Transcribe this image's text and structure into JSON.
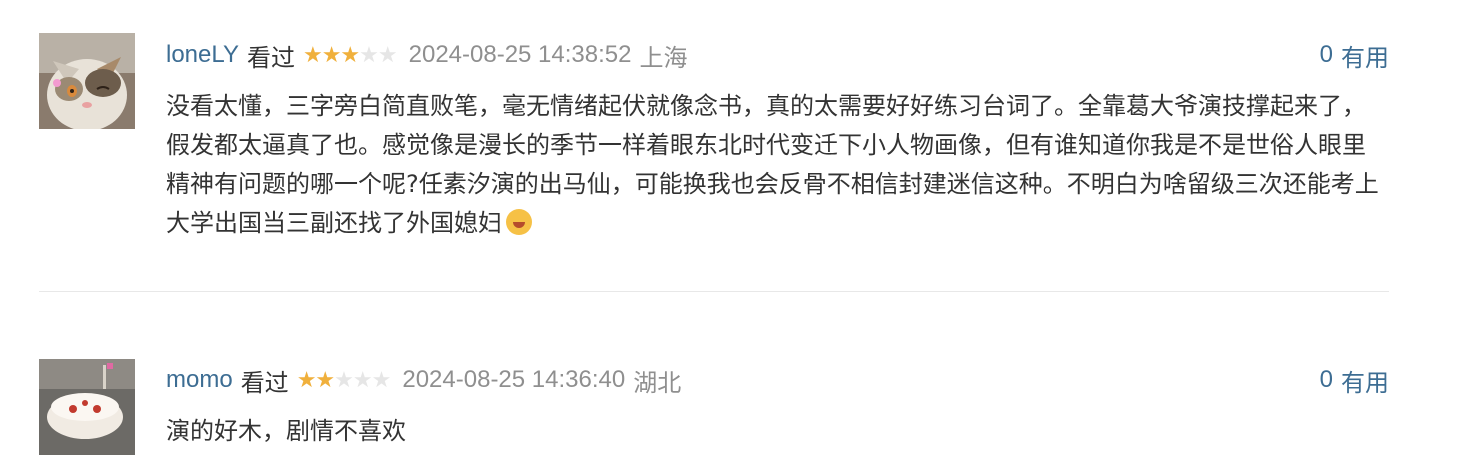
{
  "comments": [
    {
      "user": "loneLY",
      "status": "看过",
      "rating": 3,
      "max_rating": 5,
      "time": "2024-08-25 14:38:52",
      "location": "上海",
      "votes": "0",
      "vote_label": "有用",
      "text": "没看太懂，三字旁白简直败笔，毫无情绪起伏就像念书，真的太需要好好练习台词了。全靠葛大爷演技撑起来了，假发都太逼真了也。感觉像是漫长的季节一样着眼东北时代变迁下小人物画像，但有谁知道你我是不是世俗人眼里精神有问题的哪一个呢?任素汐演的出马仙，可能换我也会反骨不相信封建迷信这种。不明白为啥留级三次还能考上大学出国当三副还找了外国媳妇",
      "emoji": "rofl-emoji",
      "avatar": "cat-avatar"
    },
    {
      "user": "momo",
      "status": "看过",
      "rating": 2,
      "max_rating": 5,
      "time": "2024-08-25 14:36:40",
      "location": "湖北",
      "votes": "0",
      "vote_label": "有用",
      "text": "演的好木，剧情不喜欢",
      "avatar": "cake-avatar"
    }
  ],
  "colors": {
    "link": "#3d6d93",
    "star_on": "#f0b03c",
    "star_off": "#e6e6e6",
    "muted": "#8f8f8f",
    "text": "#333333"
  }
}
